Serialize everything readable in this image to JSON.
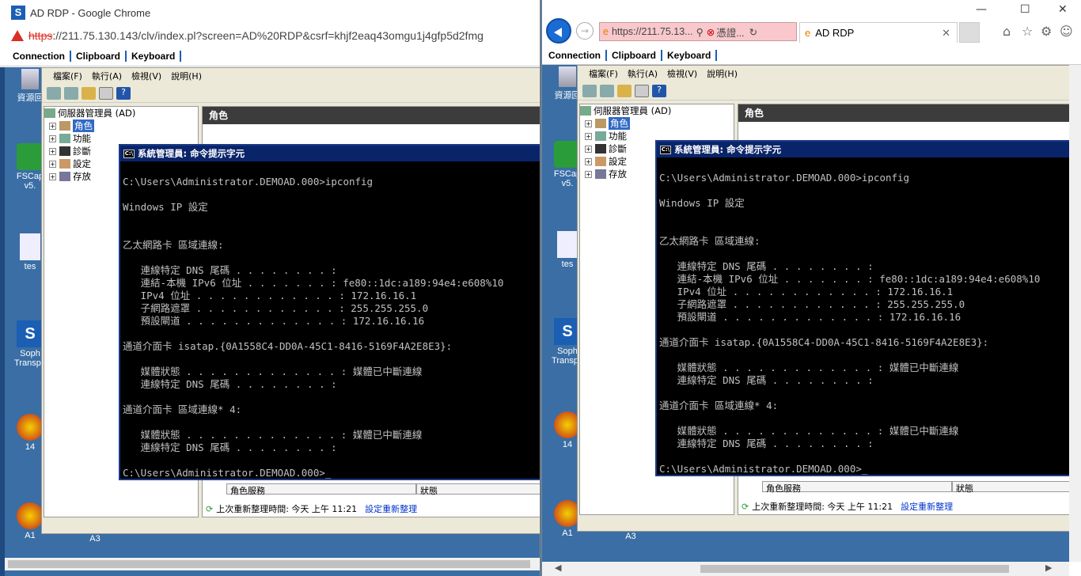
{
  "chrome": {
    "title": "AD RDP - Google Chrome",
    "url_scheme": "https",
    "url_rest": "://211.75.130.143/clv/index.pl?screen=AD%20RDP&csrf=khjf2eaq43omgu1j4gfp5d2fmg"
  },
  "toolbar": {
    "connection": "Connection",
    "clipboard": "Clipboard",
    "keyboard": "Keyboard"
  },
  "ie": {
    "address": "https://211.75.13...",
    "cert": "憑證...",
    "tab": "AD RDP"
  },
  "desktop": {
    "icon_recycle": "資源回",
    "icon_fscap_1": "FSCap",
    "icon_fscap_2": "v5.",
    "icon_test": "tes",
    "icon_sophos_1": "Soph",
    "icon_sophos_2": "Transpa",
    "icon_14": "14",
    "icon_a1": "A1",
    "icon_a3": "A3"
  },
  "srv": {
    "menu": [
      "檔案(F)",
      "執行(A)",
      "檢視(V)",
      "說明(H)"
    ],
    "tree_root": "伺服器管理員 (AD)",
    "tree_items": [
      "角色",
      "功能",
      "診斷",
      "設定",
      "存放"
    ],
    "pane_title": "角色",
    "col_service": "角色服務",
    "col_status": "狀態",
    "status_text": "上次重新整理時間: 今天 上午 11:21",
    "status_link": "設定重新整理"
  },
  "cmd": {
    "title": "系統管理員: 命令提示字元",
    "lines": [
      "",
      "C:\\Users\\Administrator.DEMOAD.000>ipconfig",
      "",
      "Windows IP 設定",
      "",
      "",
      "乙太網路卡 區域連線:",
      "",
      "   連線特定 DNS 尾碼 . . . . . . . . :",
      "   連結-本機 IPv6 位址 . . . . . . . : fe80::1dc:a189:94e4:e608%10",
      "   IPv4 位址 . . . . . . . . . . . . : 172.16.16.1",
      "   子網路遮罩 . . . . . . . . . . . . : 255.255.255.0",
      "   預設閘道 . . . . . . . . . . . . . : 172.16.16.16",
      "",
      "通道介面卡 isatap.{0A1558C4-DD0A-45C1-8416-5169F4A2E8E3}:",
      "",
      "   媒體狀態 . . . . . . . . . . . . . : 媒體已中斷連線",
      "   連線特定 DNS 尾碼 . . . . . . . . :",
      "",
      "通道介面卡 區域連線* 4:",
      "",
      "   媒體狀態 . . . . . . . . . . . . . : 媒體已中斷連線",
      "   連線特定 DNS 尾碼 . . . . . . . . :",
      "",
      "C:\\Users\\Administrator.DEMOAD.000>_"
    ]
  },
  "colors": {
    "desktop": "#3a6ea5",
    "titlebar": "#0a246a",
    "accent": "#1a5fb4",
    "warning": "#d93025"
  }
}
